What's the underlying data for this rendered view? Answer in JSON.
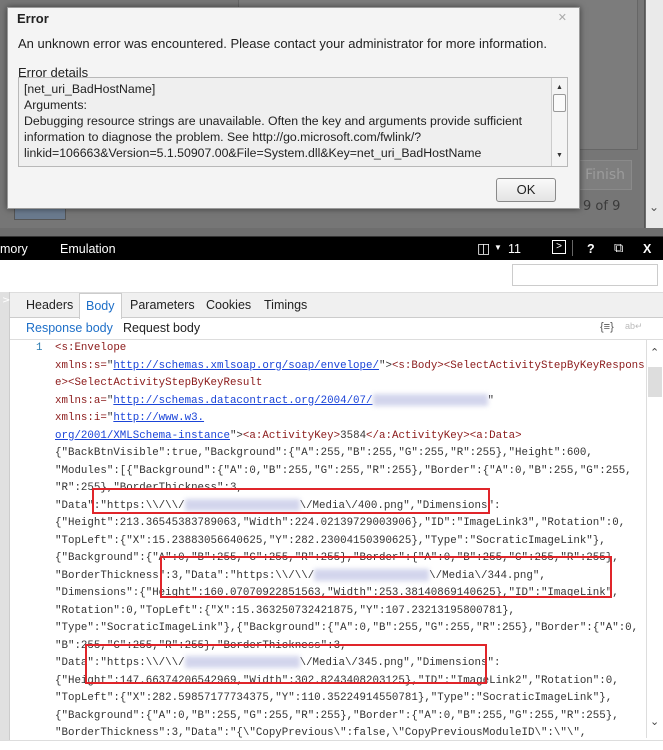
{
  "app": {
    "finish_label": "Finish",
    "pager": "9 of 9"
  },
  "dialog": {
    "title": "Error",
    "message": "An unknown error was encountered. Please contact your administrator for more information.",
    "details_label": "Error details",
    "details_lines": [
      "[net_uri_BadHostName]",
      "Arguments:",
      "Debugging resource strings are unavailable. Often the key and arguments provide sufficient",
      "information to diagnose the problem. See http://go.microsoft.com/fwlink/?",
      "linkid=106663&Version=5.1.50907.00&File=System.dll&Key=net_uri_BadHostName"
    ],
    "ok_label": "OK"
  },
  "devtools": {
    "toolbar": {
      "memory": "mory",
      "emulation": "Emulation",
      "doc_mode": "11",
      "help": "?",
      "close": "X"
    },
    "tabs": [
      "Headers",
      "Body",
      "Parameters",
      "Cookies",
      "Timings"
    ],
    "active_tab": "Body",
    "subtabs": [
      "Response body",
      "Request body"
    ],
    "line_number": "1",
    "code_lines": [
      [
        [
          "<s:Envelope",
          "t"
        ]
      ],
      [
        [
          "xmlns:s=",
          "at"
        ],
        [
          "\"",
          "p"
        ],
        [
          "http://schemas.xmlsoap.org/soap/envelope/",
          "l"
        ],
        [
          "\">",
          "p"
        ],
        [
          "<s:Body><SelectActivityStepByKeyRespons",
          "t"
        ]
      ],
      [
        [
          "e><SelectActivityStepByKeyResult",
          "t"
        ]
      ],
      [
        [
          "xmlns:a=",
          "at"
        ],
        [
          "\"",
          "p"
        ],
        [
          "http://schemas.datacontract.org/2004/07/",
          "l"
        ],
        [
          "",
          "b"
        ],
        [
          "\"",
          "p"
        ]
      ],
      [
        [
          "xmlns:i=",
          "at"
        ],
        [
          "\"",
          "p"
        ],
        [
          "http://www.w3.",
          "l"
        ]
      ],
      [
        [
          "org/2001/XMLSchema-instance",
          "l"
        ],
        [
          "\">",
          "p"
        ],
        [
          "<a:ActivityKey>",
          "t"
        ],
        [
          "3584",
          "p"
        ],
        [
          "</a:ActivityKey><a:Data>",
          "t"
        ]
      ],
      [
        [
          "{\"BackBtnVisible\":true,\"Background\":{\"A\":255,\"B\":255,\"G\":255,\"R\":255},\"Height\":600,",
          "p"
        ]
      ],
      [
        [
          "\"Modules\":[{\"Background\":{\"A\":0,\"B\":255,\"G\":255,\"R\":255},\"Border\":{\"A\":0,\"B\":255,\"G\":255,",
          "p"
        ]
      ],
      [
        [
          "\"R\":255},\"BorderThickness\":3,",
          "p"
        ]
      ],
      [
        [
          "\"Data\":\"https:\\\\/\\\\/",
          "p"
        ],
        [
          "",
          "b"
        ],
        [
          "\\/Media\\/400.png\",\"Dimensions\":",
          "p"
        ]
      ],
      [
        [
          "{\"Height\":213.36545383789063,\"Width\":224.02139729003906},\"ID\":\"ImageLink3\",\"Rotation\":0,",
          "p"
        ]
      ],
      [
        [
          "\"TopLeft\":{\"X\":15.23883056640625,\"Y\":282.23004150390625},\"Type\":\"SocraticImageLink\"},",
          "p"
        ]
      ],
      [
        [
          "{\"Background\":{\"A\":0,\"B\":255,\"G\":255,\"R\":255},\"Border\":{\"A\":0,\"B\":255,\"G\":255,\"R\":255},",
          "p"
        ]
      ],
      [
        [
          "\"BorderThickness\":3,\"Data\":\"https:\\\\/\\\\/",
          "p"
        ],
        [
          "",
          "b"
        ],
        [
          "\\/Media\\/344.png\",",
          "p"
        ]
      ],
      [
        [
          "\"Dimensions\":{\"Height\":160.07070922851563,\"Width\":253.38140869140625},\"ID\":\"ImageLink\",",
          "p"
        ]
      ],
      [
        [
          "\"Rotation\":0,\"TopLeft\":{\"X\":15.363250732421875,\"Y\":107.23213195800781},",
          "p"
        ]
      ],
      [
        [
          "\"Type\":\"SocraticImageLink\"},{\"Background\":{\"A\":0,\"B\":255,\"G\":255,\"R\":255},\"Border\":{\"A\":0,",
          "p"
        ]
      ],
      [
        [
          "\"B\":255,\"G\":255,\"R\":255},\"BorderThickness\":3,",
          "p"
        ]
      ],
      [
        [
          "\"Data\":\"https:\\\\/\\\\/",
          "p"
        ],
        [
          "",
          "b"
        ],
        [
          "\\/Media\\/345.png\",\"Dimensions\":",
          "p"
        ]
      ],
      [
        [
          "{\"Height\":147.66374206542969,\"Width\":302.8243408203125},\"ID\":\"ImageLink2\",\"Rotation\":0,",
          "p"
        ]
      ],
      [
        [
          "\"TopLeft\":{\"X\":282.59857177734375,\"Y\":110.35224914550781},\"Type\":\"SocraticImageLink\"},",
          "p"
        ]
      ],
      [
        [
          "{\"Background\":{\"A\":0,\"B\":255,\"G\":255,\"R\":255},\"Border\":{\"A\":0,\"B\":255,\"G\":255,\"R\":255},",
          "p"
        ]
      ],
      [
        [
          "\"BorderThickness\":3,\"Data\":\"{\\\"CopyPrevious\\\":false,\\\"CopyPreviousModuleID\\\":\\\"\\\",",
          "p"
        ]
      ]
    ]
  },
  "colors": {
    "highlight_box": "#e0252a",
    "accent": "#1e6fc8"
  }
}
